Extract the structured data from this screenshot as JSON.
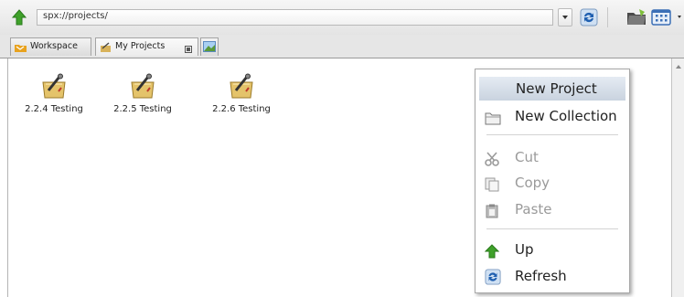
{
  "toolbar": {
    "address": "spx://projects/"
  },
  "tabs": [
    {
      "label": "Workspace"
    },
    {
      "label": "My Projects"
    }
  ],
  "projects": [
    {
      "label": "2.2.4 Testing"
    },
    {
      "label": "2.2.5 Testing"
    },
    {
      "label": "2.2.6 Testing"
    }
  ],
  "context_menu": {
    "items": [
      {
        "label": "New Project",
        "enabled": true,
        "highlighted": true
      },
      {
        "label": "New Collection",
        "enabled": true
      },
      {
        "label": "Cut",
        "enabled": false
      },
      {
        "label": "Copy",
        "enabled": false
      },
      {
        "label": "Paste",
        "enabled": false
      },
      {
        "label": "Up",
        "enabled": true
      },
      {
        "label": "Refresh",
        "enabled": true
      }
    ]
  },
  "icons": {
    "up": "green-up-arrow-icon",
    "refresh": "refresh-icon",
    "folder": "folder-icon",
    "grid_view": "grid-view-icon",
    "project": "project-icon",
    "workspace": "workspace-icon",
    "collection": "collection-folder-icon",
    "cut": "scissors-icon",
    "copy": "copy-icon",
    "paste": "paste-icon",
    "close_tab": "close-tab-icon",
    "new_tab": "new-tab-icon"
  }
}
